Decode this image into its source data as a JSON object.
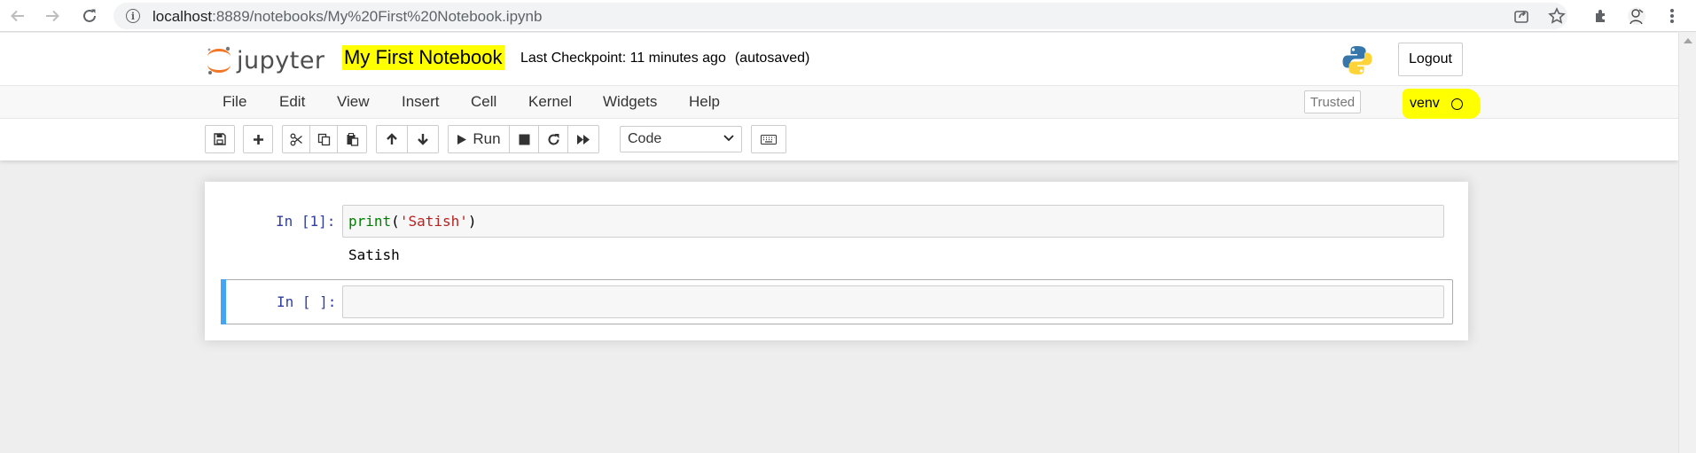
{
  "browser": {
    "url_host": "localhost",
    "url_rest": ":8889/notebooks/My%20First%20Notebook.ipynb"
  },
  "header": {
    "logo_text": "jupyter",
    "notebook_title": "My First Notebook",
    "checkpoint_label": "Last Checkpoint: 11 minutes ago",
    "autosave_status": "(autosaved)",
    "logout_label": "Logout"
  },
  "menubar": {
    "items": [
      "File",
      "Edit",
      "View",
      "Insert",
      "Cell",
      "Kernel",
      "Widgets",
      "Help"
    ],
    "trusted_label": "Trusted",
    "kernel_name": "venv",
    "kernel_status": "idle"
  },
  "toolbar": {
    "run_label": "Run",
    "cell_type": "Code"
  },
  "cells": [
    {
      "prompt": "In [1]:",
      "code_func": "print",
      "code_open": "(",
      "code_string": "'Satish'",
      "code_close": ")",
      "output": "Satish"
    },
    {
      "prompt": "In [ ]:",
      "code": ""
    }
  ],
  "colors": {
    "highlight": "#ffff00",
    "selected_cell_bar": "#42a5f5",
    "prompt": "#303f9f"
  }
}
